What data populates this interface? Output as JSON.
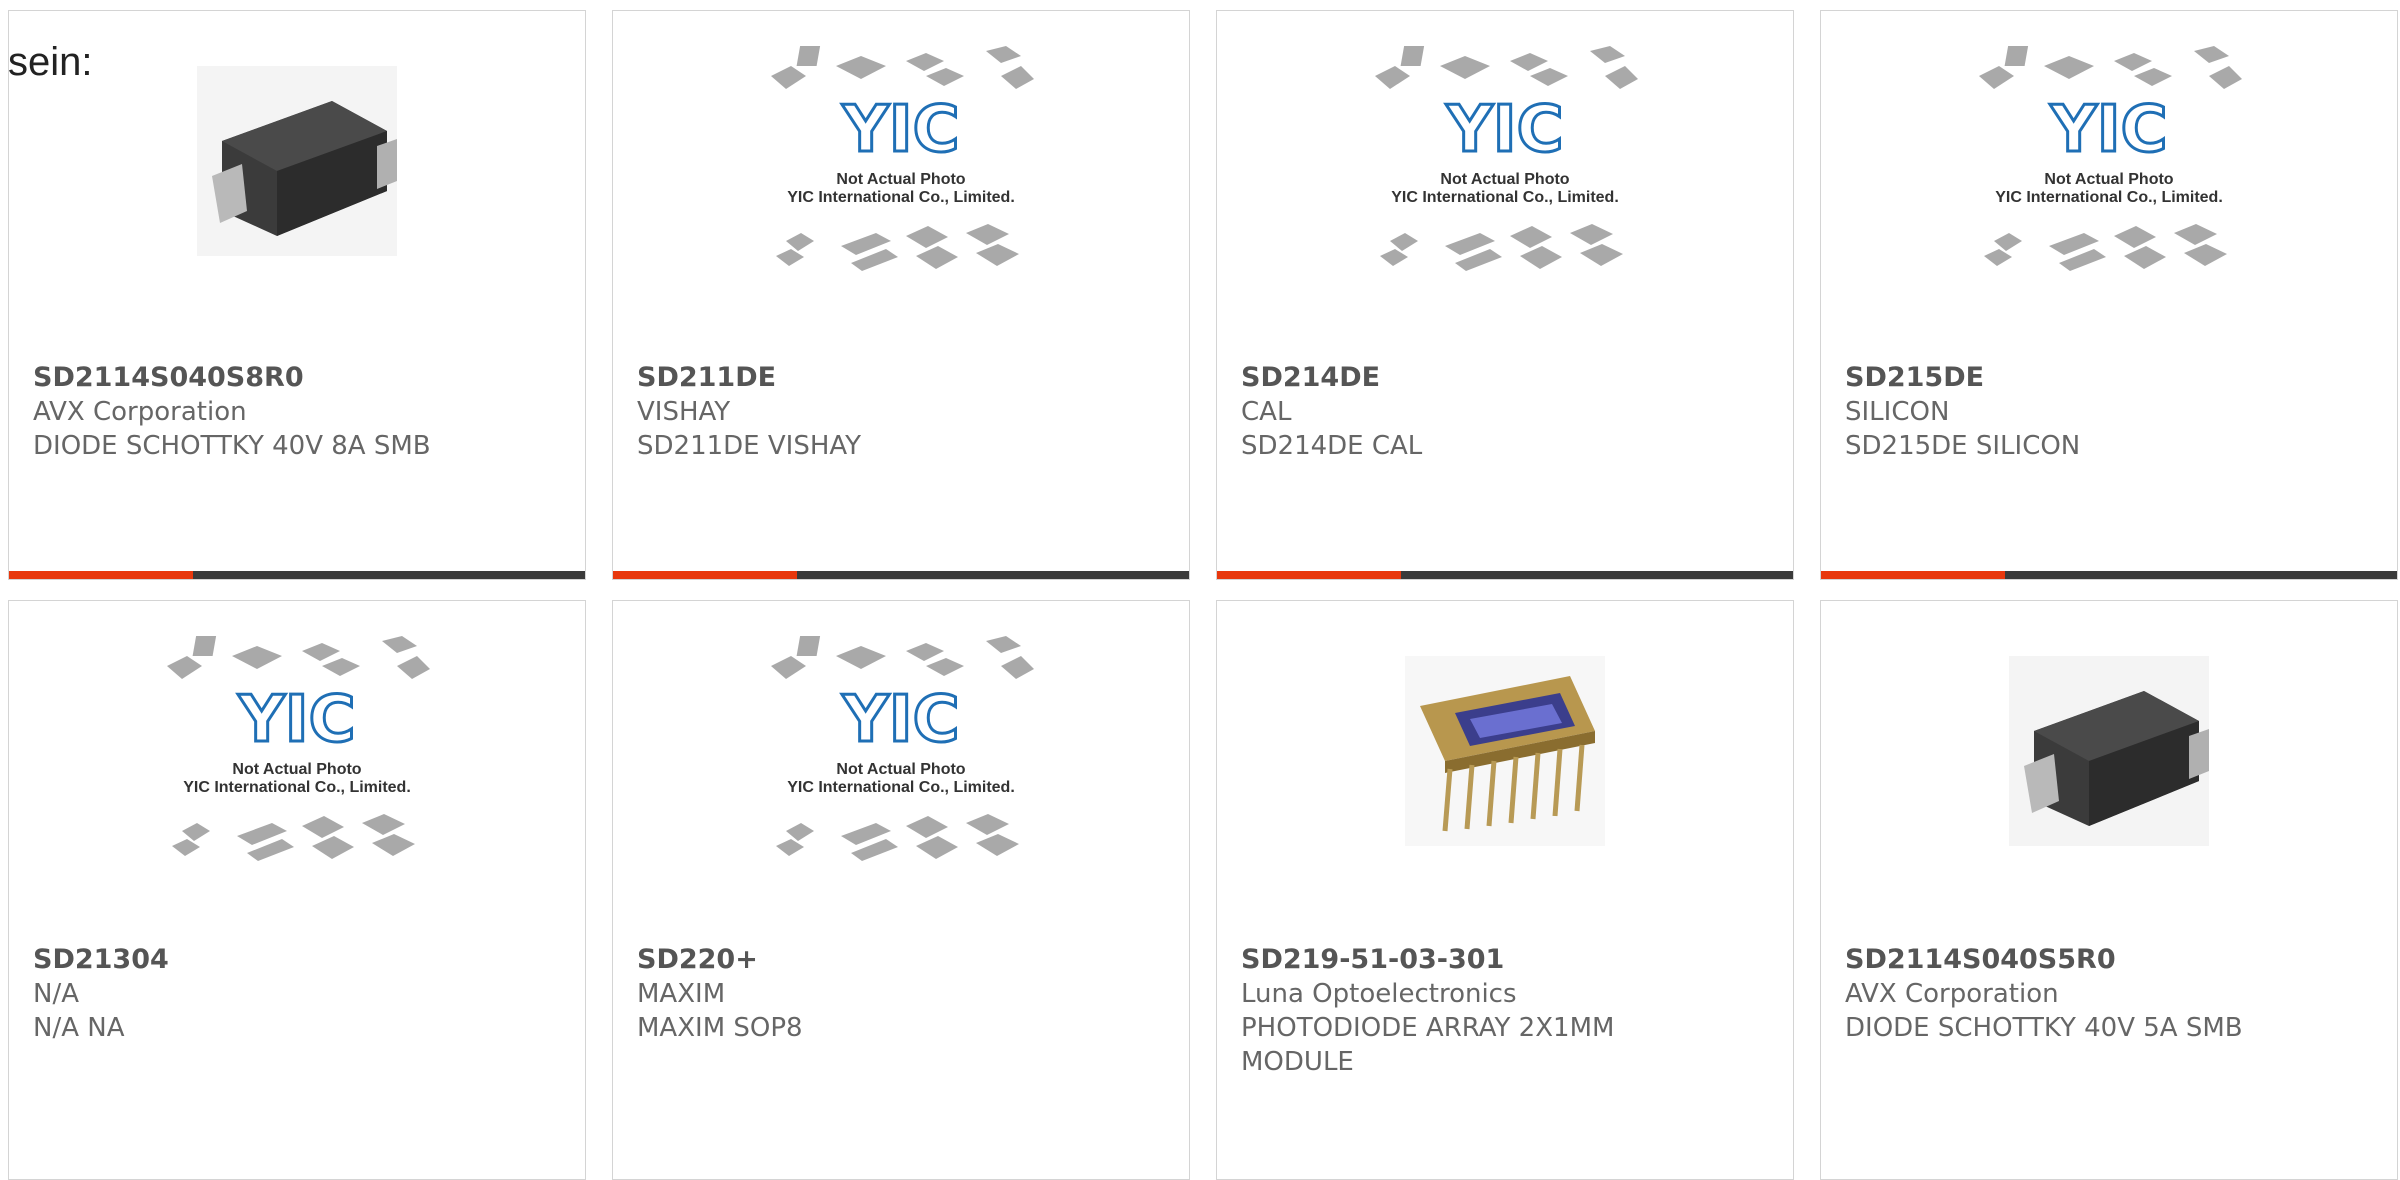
{
  "intro_text": "sein:",
  "colors": {
    "accent": "#e8380d",
    "bar_dark": "#3a3a3a",
    "border": "#d4d4d4"
  },
  "placeholder": {
    "line1": "Not Actual Photo",
    "line2": "YIC International Co., Limited.",
    "logo": "YIC"
  },
  "products": [
    {
      "part": "SD2114S040S8R0",
      "manufacturer": "AVX Corporation",
      "description": "DIODE SCHOTTKY 40V 8A SMB",
      "image": "smb-diode-icon"
    },
    {
      "part": "SD211DE",
      "manufacturer": "VISHAY",
      "description": "SD211DE VISHAY",
      "image": "placeholder"
    },
    {
      "part": "SD214DE",
      "manufacturer": "CAL",
      "description": "SD214DE CAL",
      "image": "placeholder"
    },
    {
      "part": "SD215DE",
      "manufacturer": "SILICON",
      "description": "SD215DE SILICON",
      "image": "placeholder"
    },
    {
      "part": "SD21304",
      "manufacturer": "N/A",
      "description": "N/A NA",
      "image": "placeholder"
    },
    {
      "part": "SD220+",
      "manufacturer": "MAXIM",
      "description": "MAXIM SOP8",
      "image": "placeholder"
    },
    {
      "part": "SD219-51-03-301",
      "manufacturer": "Luna Optoelectronics",
      "description": "PHOTODIODE ARRAY 2X1MM MODULE",
      "image": "photodiode-array-icon"
    },
    {
      "part": "SD2114S040S5R0",
      "manufacturer": "AVX Corporation",
      "description": "DIODE SCHOTTKY 40V 5A SMB",
      "image": "smb-diode-icon"
    }
  ]
}
